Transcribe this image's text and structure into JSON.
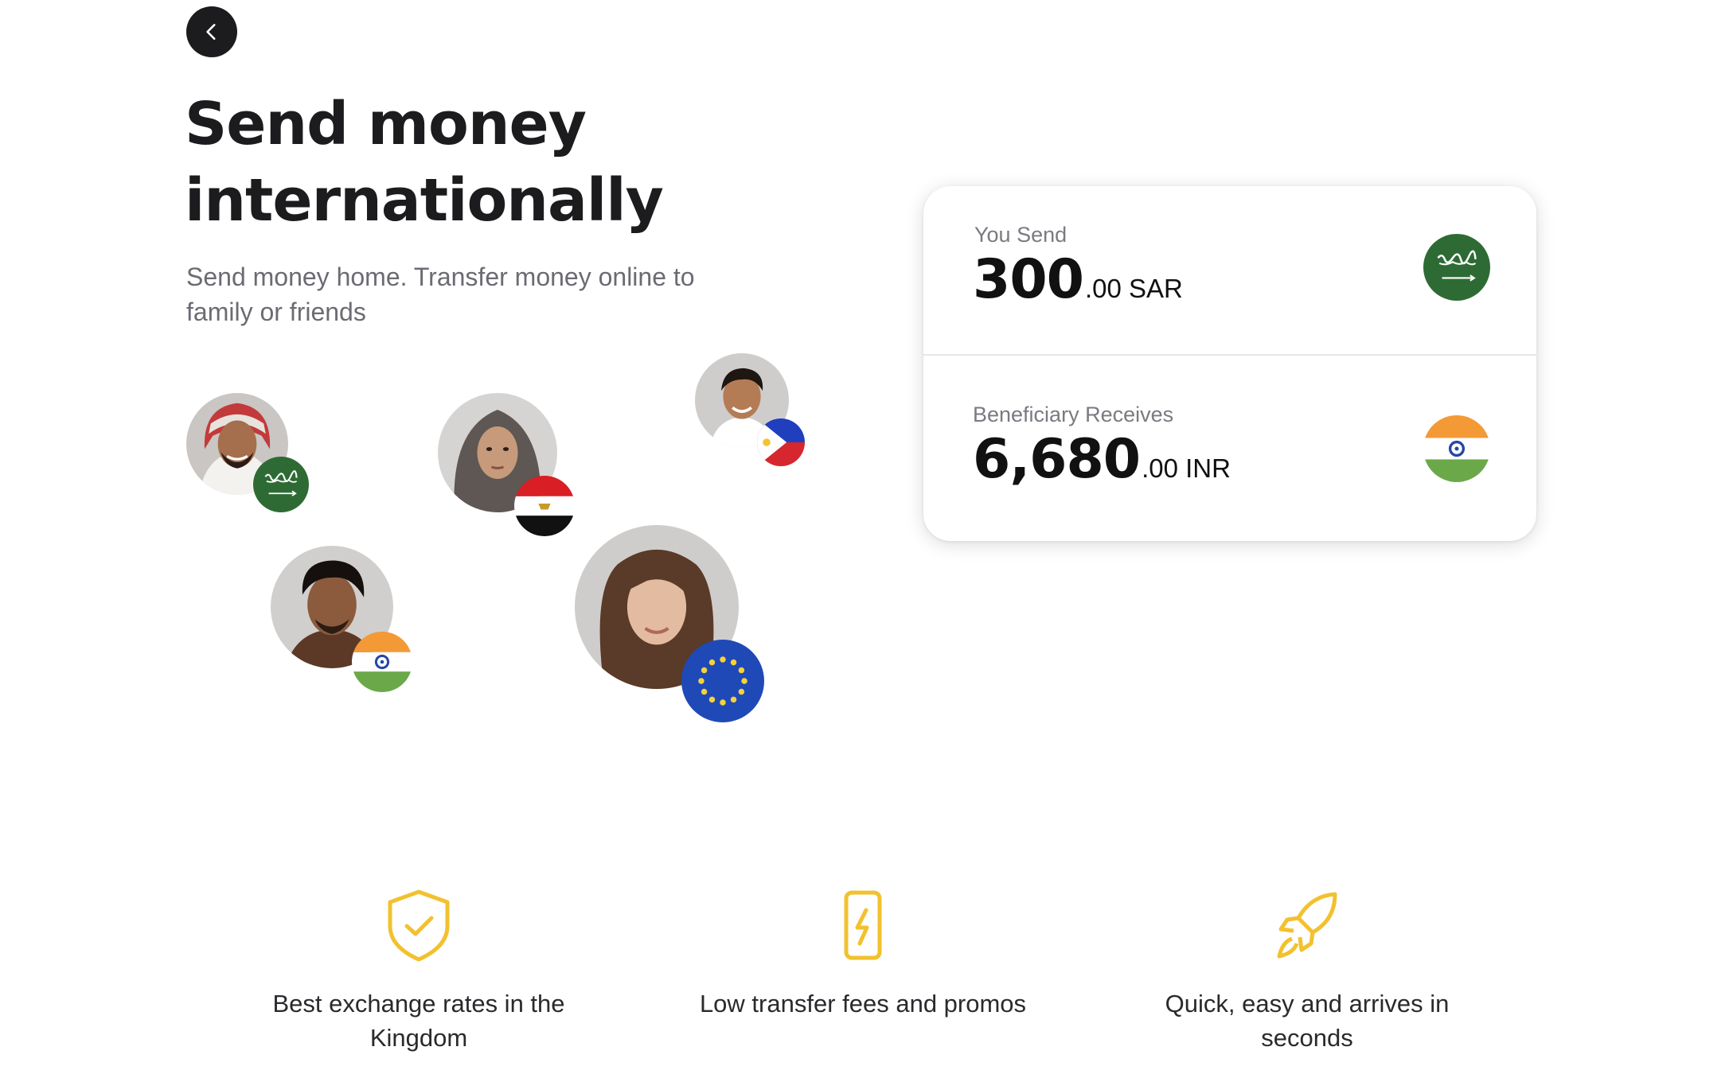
{
  "header": {
    "back_icon": "chevron-left-icon"
  },
  "hero": {
    "title_line1": "Send money",
    "title_line2": "internationally",
    "subtitle": "Send money home. Transfer money online to family or friends"
  },
  "avatars": [
    {
      "person": "man-in-ghutra",
      "flag": "saudi-arabia-flag"
    },
    {
      "person": "woman-in-hijab",
      "flag": "egypt-flag"
    },
    {
      "person": "young-man",
      "flag": "philippines-flag"
    },
    {
      "person": "man",
      "flag": "india-flag"
    },
    {
      "person": "woman",
      "flag": "eu-flag"
    }
  ],
  "converter": {
    "send": {
      "label": "You Send",
      "amount_major": "300",
      "amount_minor": ".00 SAR",
      "flag": "saudi-arabia-flag"
    },
    "receive": {
      "label": "Beneficiary Receives",
      "amount_major": "6,680",
      "amount_minor": ".00 INR",
      "flag": "india-flag"
    }
  },
  "features": [
    {
      "icon": "shield-check-icon",
      "label_line1": "Best exchange rates in the",
      "label_line2": "Kingdom"
    },
    {
      "icon": "phone-bolt-icon",
      "label_line1": "Low transfer fees and promos",
      "label_line2": ""
    },
    {
      "icon": "rocket-icon",
      "label_line1": "Quick, easy and arrives in",
      "label_line2": "seconds"
    }
  ],
  "colors": {
    "accent": "#F2C12E",
    "dark": "#1C1C1E",
    "saudi_green": "#2E6B34",
    "india_saffron": "#F39A36",
    "india_green": "#6BA84A",
    "eu_blue": "#1F49B6"
  }
}
